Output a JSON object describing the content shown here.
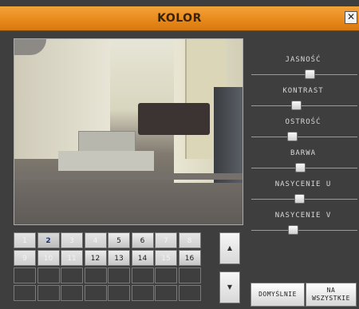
{
  "window": {
    "title": "KOLOR",
    "close_label": "✕"
  },
  "sliders": [
    {
      "label": "JASNOŚĆ",
      "value": 0.55
    },
    {
      "label": "KONTRAST",
      "value": 0.42
    },
    {
      "label": "OSTROŚĆ",
      "value": 0.38
    },
    {
      "label": "BARWA",
      "value": 0.46
    },
    {
      "label": "NASYCENIE  U",
      "value": 0.45
    },
    {
      "label": "NASYCENIE  V",
      "value": 0.39
    }
  ],
  "camera_grid": {
    "cells": [
      "1",
      "2",
      "3",
      "4",
      "5",
      "6",
      "7",
      "8",
      "9",
      "10",
      "11",
      "12",
      "13",
      "14",
      "15",
      "16"
    ],
    "selected": "2",
    "active": [
      "5",
      "6",
      "12",
      "13",
      "14",
      "16"
    ]
  },
  "arrows": {
    "up": "▲",
    "down": "▼"
  },
  "buttons": {
    "default_label": "DOMYŚLNIE",
    "apply_all_label": "NA WSZYSTKIE"
  }
}
